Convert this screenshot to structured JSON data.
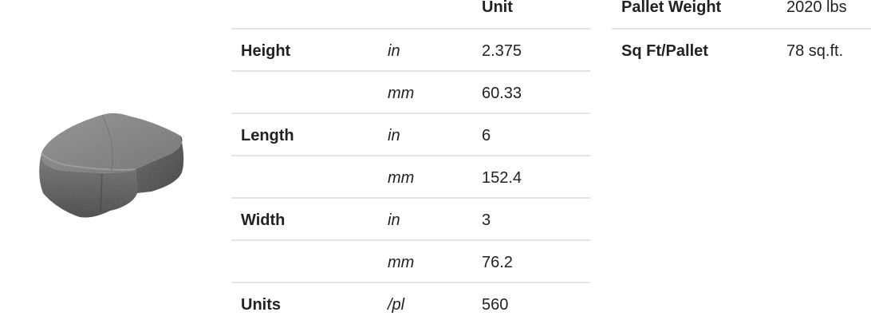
{
  "product": {
    "image_name": "paver-brick"
  },
  "spec_table": {
    "header_unit": "Unit",
    "rows": [
      {
        "label": "Height",
        "unit": "in",
        "value": "2.375"
      },
      {
        "label": "",
        "unit": "mm",
        "value": "60.33"
      },
      {
        "label": "Length",
        "unit": "in",
        "value": "6"
      },
      {
        "label": "",
        "unit": "mm",
        "value": "152.4"
      },
      {
        "label": "Width",
        "unit": "in",
        "value": "3"
      },
      {
        "label": "",
        "unit": "mm",
        "value": "76.2"
      },
      {
        "label": "Units",
        "unit": "/pl",
        "value": "560"
      }
    ]
  },
  "pallet_table": {
    "rows": [
      {
        "label": "Pallet Weight",
        "value": "2020 lbs"
      },
      {
        "label": "Sq Ft/Pallet",
        "value": "78 sq.ft."
      }
    ]
  },
  "colors": {
    "text": "#222222",
    "divider": "#e4e4e4",
    "brick_dark": "#4a4a4a",
    "brick_mid": "#7a7a7a",
    "brick_light": "#9a9a9a"
  }
}
